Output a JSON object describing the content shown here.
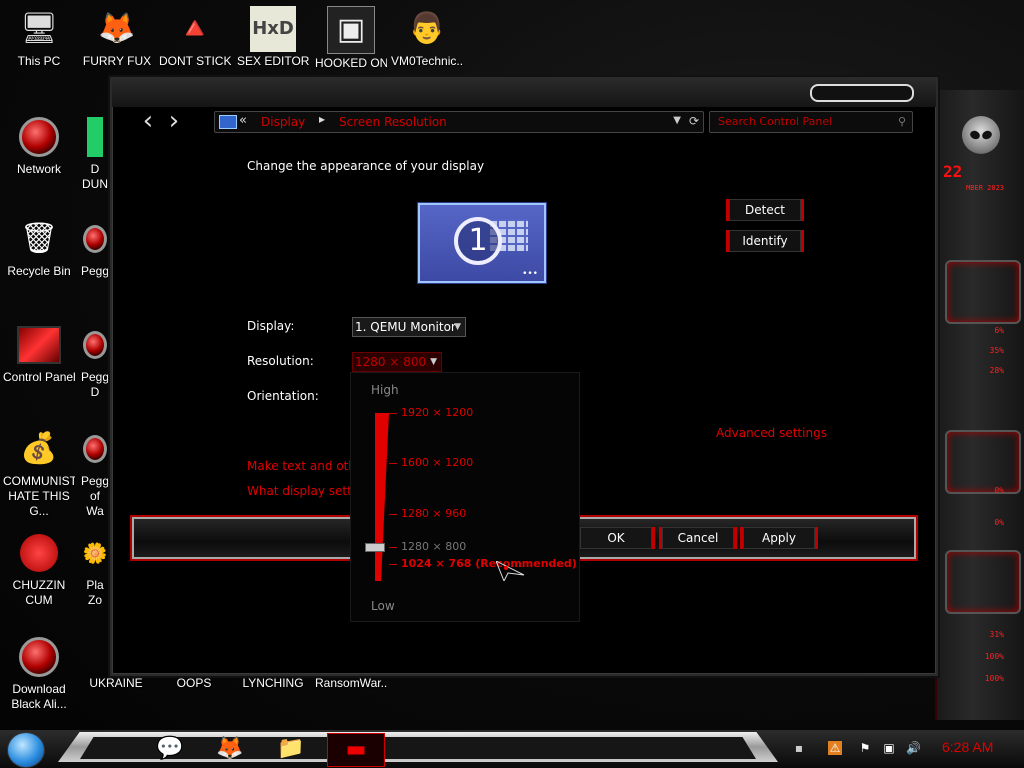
{
  "desktop": {
    "icons": [
      {
        "label": "This PC",
        "glyph": "🖥"
      },
      {
        "label": "FURRY FUX",
        "glyph": "🦊"
      },
      {
        "label": "DONT STICK",
        "glyph": "🔺"
      },
      {
        "label": "SEX EDITOR",
        "glyph": "HxD"
      },
      {
        "label": "HOOKED ON",
        "glyph": "▣"
      },
      {
        "label": "VM0Technic...",
        "glyph": "👨"
      },
      {
        "label": "Network",
        "glyph": ""
      },
      {
        "label": "D DUN",
        "glyph": ""
      },
      {
        "label": "Recycle Bin",
        "glyph": "🗑"
      },
      {
        "label": "Pegg",
        "glyph": ""
      },
      {
        "label": "Control Panel",
        "glyph": ""
      },
      {
        "label": "Pegg D",
        "glyph": ""
      },
      {
        "label": "COMMUNISTS HATE THIS G...",
        "glyph": "💰"
      },
      {
        "label": "Pegg of Wa",
        "glyph": ""
      },
      {
        "label": "CHUZZIN CUM",
        "glyph": ""
      },
      {
        "label": "Pla Zo",
        "glyph": "🌼"
      },
      {
        "label": "Download Black Ali...",
        "glyph": ""
      },
      {
        "label": "UKRAINE",
        "glyph": ""
      },
      {
        "label": "OOPS",
        "glyph": ""
      },
      {
        "label": "LYNCHING",
        "glyph": ""
      },
      {
        "label": "RansomWar...",
        "glyph": ""
      }
    ]
  },
  "gadget": {
    "percents": [
      "6%",
      "35%",
      "28%",
      "0%",
      "0%",
      "31%",
      "100%",
      "100%"
    ],
    "nums": [
      "22",
      "MBER 2023"
    ]
  },
  "window": {
    "nav_back": "‹",
    "nav_forward": "›",
    "breadcrumb": {
      "prefix": "«",
      "item1": "Display",
      "separator": "▸",
      "item2": "Screen Resolution"
    },
    "search_placeholder": "Search Control Panel",
    "heading": "Change the appearance of your display",
    "monitor_number": "1",
    "detect_label": "Detect",
    "identify_label": "Identify",
    "display_label": "Display:",
    "display_value": "1. QEMU Monitor",
    "resolution_label": "Resolution:",
    "resolution_value": "1280 × 800",
    "orientation_label": "Orientation:",
    "advanced_link": "Advanced settings",
    "link_text_size": "Make text and other",
    "link_display_settings": "What display setting",
    "ok_label": "OK",
    "cancel_label": "Cancel",
    "apply_label": "Apply"
  },
  "resolution_popup": {
    "high_label": "High",
    "low_label": "Low",
    "options": [
      {
        "label": "1920 × 1200",
        "color": "#e00000",
        "bold": false,
        "level": 1.0
      },
      {
        "label": "1600 × 1200",
        "color": "#e00000",
        "bold": false,
        "level": 0.7
      },
      {
        "label": "1280 × 960",
        "color": "#e00000",
        "bold": false,
        "level": 0.4
      },
      {
        "label": "1280 × 800",
        "color": "#777777",
        "bold": false,
        "level": 0.2
      },
      {
        "label": "1024 × 768 (Recommended)",
        "color": "#e00000",
        "bold": true,
        "level": 0.1
      }
    ],
    "selected_level": 0.2
  },
  "taskbar": {
    "clock": "6:28 AM",
    "apps": [
      "💬",
      "🦊",
      "📁",
      "▬"
    ]
  }
}
